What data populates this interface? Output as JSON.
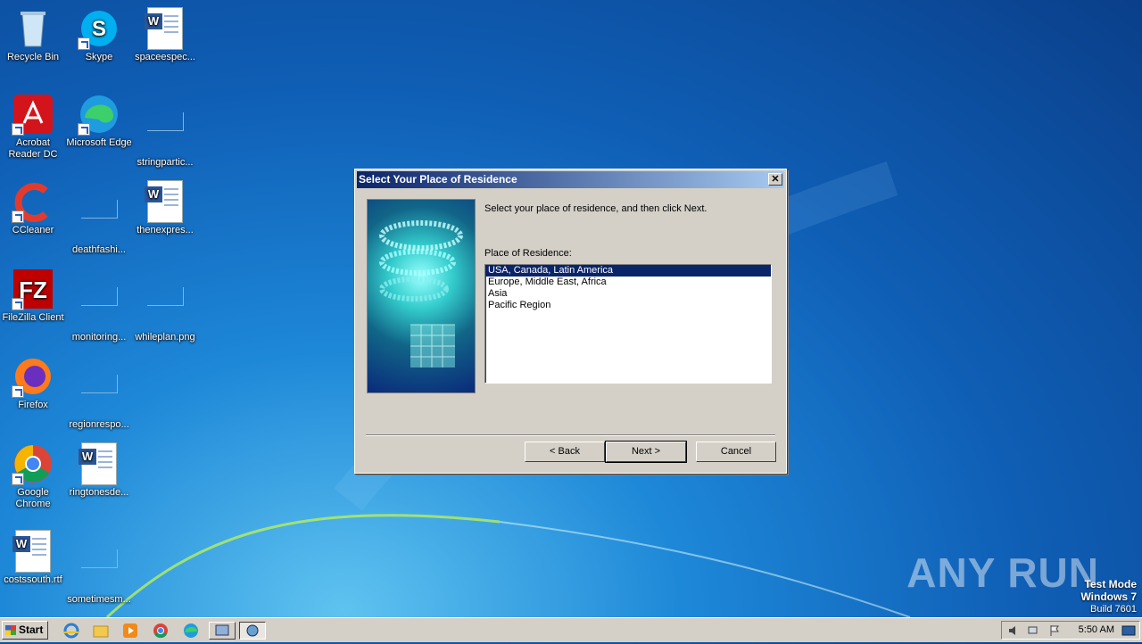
{
  "desktop": {
    "icons": [
      {
        "label": "Recycle Bin"
      },
      {
        "label": "Skype"
      },
      {
        "label": "spaceespec..."
      },
      {
        "label": "Acrobat Reader DC"
      },
      {
        "label": "Microsoft Edge"
      },
      {
        "label": "stringpartic..."
      },
      {
        "label": "CCleaner"
      },
      {
        "label": "deathfashi..."
      },
      {
        "label": "thenexpres..."
      },
      {
        "label": "FileZilla Client"
      },
      {
        "label": "monitoring..."
      },
      {
        "label": "whileplan.png"
      },
      {
        "label": "Firefox"
      },
      {
        "label": "regionrespo..."
      },
      {
        "label": "Google Chrome"
      },
      {
        "label": "ringtonesde..."
      },
      {
        "label": "costssouth.rtf"
      },
      {
        "label": "sometimesm..."
      }
    ]
  },
  "dialog": {
    "title": "Select Your Place of Residence",
    "instruction": "Select your place of residence, and then click Next.",
    "list_label": "Place of Residence:",
    "options": [
      {
        "label": "USA, Canada, Latin America",
        "selected": true
      },
      {
        "label": "Europe, Middle East, Africa"
      },
      {
        "label": "Asia"
      },
      {
        "label": "Pacific Region"
      }
    ],
    "back_label": "< Back",
    "next_label": "Next >",
    "cancel_label": "Cancel",
    "close_glyph": "✕"
  },
  "taskbar": {
    "start_label": "Start",
    "clock": "5:50 AM"
  },
  "overlay": {
    "watermark": "ANY RUN",
    "test_mode": "Test Mode",
    "os": "Windows 7",
    "build": "Build 7601"
  }
}
